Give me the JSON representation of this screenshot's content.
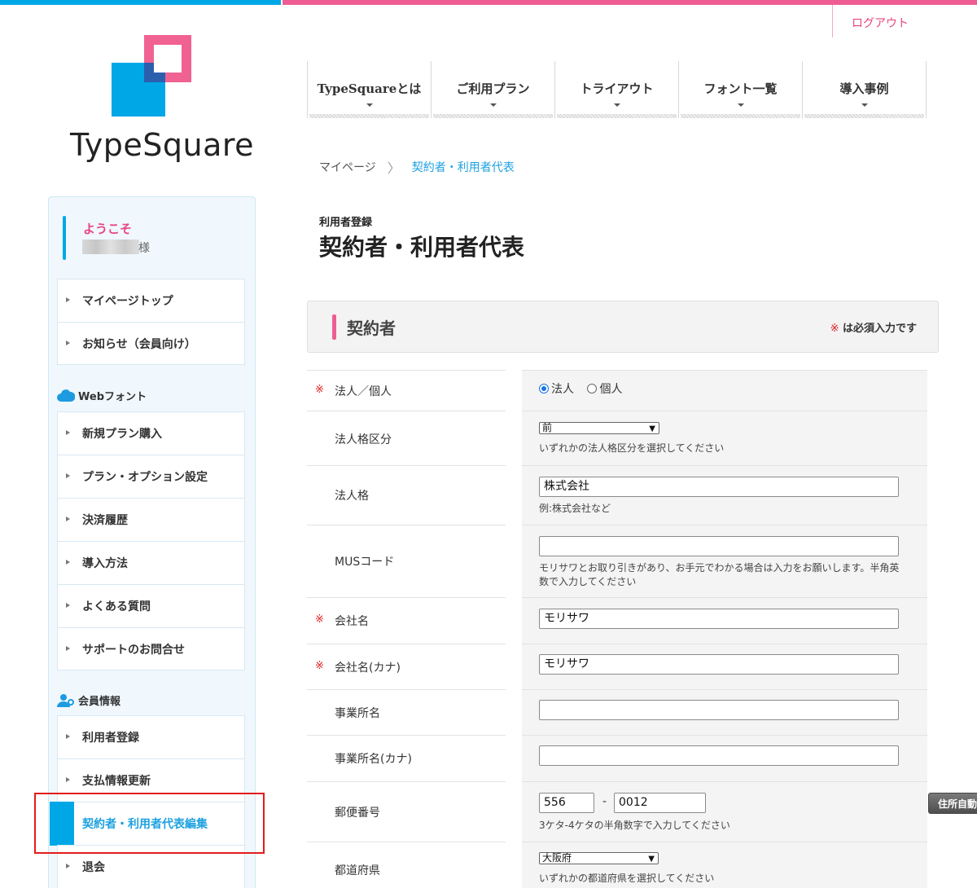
{
  "header": {
    "logout_label": "ログアウト"
  },
  "logo": {
    "text": "TypeSquare"
  },
  "nav": [
    {
      "label": "TypeSquareとは"
    },
    {
      "label": "ご利用プラン"
    },
    {
      "label": "トライアウト"
    },
    {
      "label": "フォント一覧"
    },
    {
      "label": "導入事例"
    }
  ],
  "breadcrumb": {
    "home": "マイページ",
    "separator": "〉",
    "current": "契約者・利用者代表"
  },
  "page": {
    "subtitle": "利用者登録",
    "title": "契約者・利用者代表"
  },
  "section": {
    "title": "契約者",
    "required_mark": "※",
    "required_note": " は必須入力です"
  },
  "form": {
    "required_mark": "※",
    "entity": {
      "label": "法人／個人",
      "option1": "法人",
      "option2": "個人",
      "selected": "法人"
    },
    "corp_type_position": {
      "label": "法人格区分",
      "value": "前",
      "hint": "いずれかの法人格区分を選択してください"
    },
    "corp_type": {
      "label": "法人格",
      "value": "株式会社",
      "hint": "例:株式会社など"
    },
    "mus_code": {
      "label": "MUSコード",
      "value": "",
      "hint": "モリサワとお取り引きがあり、お手元でわかる場合は入力をお願いします。半角英数で入力してください"
    },
    "company_name": {
      "label": "会社名",
      "value": "モリサワ"
    },
    "company_kana": {
      "label": "会社名(カナ)",
      "value": "モリサワ"
    },
    "office_name": {
      "label": "事業所名",
      "value": ""
    },
    "office_kana": {
      "label": "事業所名(カナ)",
      "value": ""
    },
    "postal": {
      "label": "郵便番号",
      "part1": "556",
      "dash": "-",
      "part2": "0012",
      "button": "住所自動入力",
      "hint": "3ケタ-4ケタの半角数字で入力してください"
    },
    "prefecture": {
      "label": "都道府県",
      "value": "大阪府",
      "hint": "いずれかの都道府県を選択してください"
    }
  },
  "sidebar": {
    "welcome": "ようこそ",
    "user_suffix": "様",
    "top_items": [
      {
        "label": "マイページトップ"
      },
      {
        "label": "お知らせ（会員向け）"
      }
    ],
    "webfont_heading": "Webフォント",
    "webfont_items": [
      {
        "label": "新規プラン購入"
      },
      {
        "label": "プラン・オプション設定"
      },
      {
        "label": "決済履歴"
      },
      {
        "label": "導入方法"
      },
      {
        "label": "よくある質問"
      },
      {
        "label": "サポートのお問合せ"
      }
    ],
    "member_heading": "会員情報",
    "member_items": [
      {
        "label": "利用者登録"
      },
      {
        "label": "支払情報更新"
      },
      {
        "label": "契約者・利用者代表編集"
      },
      {
        "label": "退会"
      }
    ]
  },
  "colors": {
    "brand_blue": "#00a7e6",
    "brand_pink": "#ee5c93",
    "highlight_red": "#e41b1b",
    "required_red": "#e02020"
  }
}
